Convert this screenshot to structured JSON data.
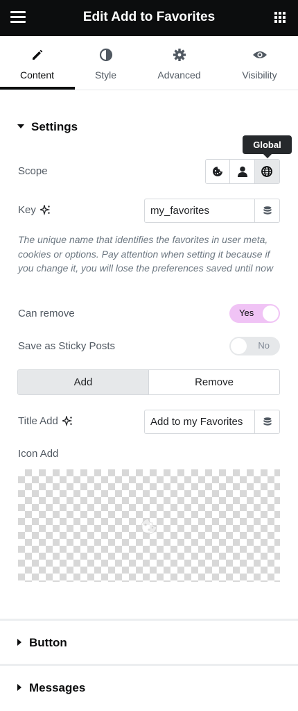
{
  "header": {
    "title": "Edit Add to Favorites",
    "menu_icon": "hamburger-icon",
    "apps_icon": "grid-icon"
  },
  "tabs": [
    {
      "label": "Content",
      "icon": "pencil-icon",
      "active": true
    },
    {
      "label": "Style",
      "icon": "half-circle-icon",
      "active": false
    },
    {
      "label": "Advanced",
      "icon": "gear-icon",
      "active": false
    },
    {
      "label": "Visibility",
      "icon": "eye-icon",
      "active": false
    }
  ],
  "settings": {
    "title": "Settings",
    "scope": {
      "label": "Scope",
      "tooltip": "Global",
      "options": [
        "cookie-icon",
        "user-icon",
        "globe-icon"
      ],
      "selected": "globe-icon"
    },
    "key": {
      "label": "Key",
      "value": "my_favorites"
    },
    "description": "The unique name that identifies the favorites in user meta, cookies or options. Pay attention when setting it because if you change it, you will lose the preferences saved until now",
    "can_remove": {
      "label": "Can remove",
      "state": "Yes"
    },
    "sticky": {
      "label": "Save as Sticky Posts",
      "state": "No"
    },
    "switcher": {
      "options": [
        "Add",
        "Remove"
      ],
      "selected": "Add"
    },
    "title_add": {
      "label": "Title Add",
      "value": "Add to my Favorites"
    },
    "icon_add": {
      "label": "Icon Add"
    }
  },
  "sections": {
    "button": "Button",
    "messages": "Messages"
  },
  "colors": {
    "topbar": "#0c0d0e",
    "toggle_on": "#f0c3f5",
    "toggle_off": "#e6e8ea",
    "tooltip": "#26292c"
  }
}
